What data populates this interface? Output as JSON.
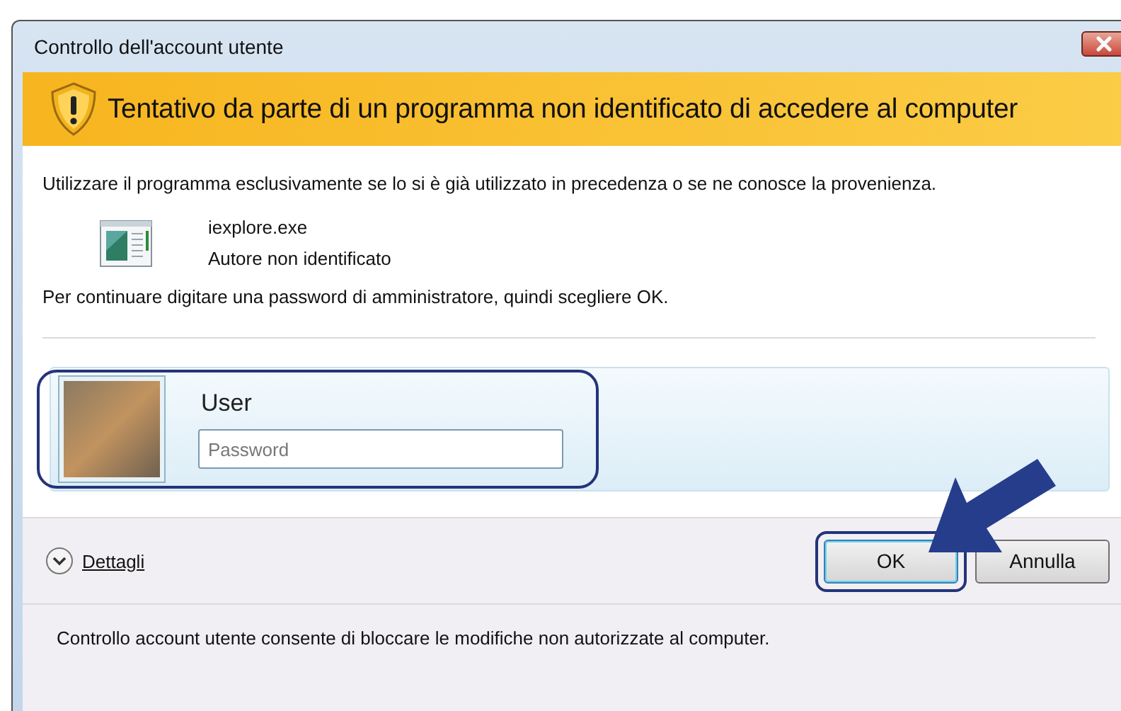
{
  "window": {
    "title": "Controllo dell'account utente"
  },
  "banner": {
    "title": "Tentativo da parte di un programma non identificato di accedere al computer"
  },
  "message": "Utilizzare il programma esclusivamente se lo si è già utilizzato in precedenza o se ne conosce la provenienza.",
  "program": {
    "name": "iexplore.exe",
    "publisher": "Autore non identificato"
  },
  "prompt": "Per continuare digitare una password di amministratore, quindi scegliere OK.",
  "credential": {
    "user": "User",
    "placeholder": "Password"
  },
  "details": {
    "label": "Dettagli",
    "expanded": false
  },
  "buttons": [
    {
      "label": "OK",
      "default": true
    },
    {
      "label": "Annulla",
      "default": false
    }
  ],
  "footer": "Controllo account utente consente di bloccare le modifiche non autorizzate al computer."
}
